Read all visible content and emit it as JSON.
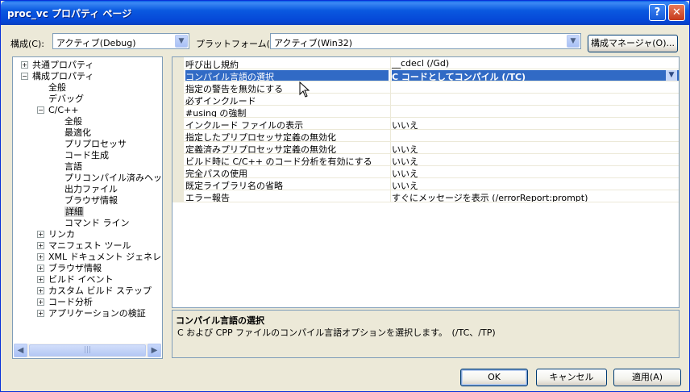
{
  "window": {
    "title": "proc_vc プロパティ ページ",
    "help_button": "?",
    "close_button": "✕"
  },
  "toolbar": {
    "config_label": "構成(C):",
    "config_value": "アクティブ(Debug)",
    "platform_label": "プラットフォーム(P):",
    "platform_value": "アクティブ(Win32)",
    "config_manager_button": "構成マネージャ(O)..."
  },
  "tree": {
    "items": [
      {
        "label": "共通プロパティ",
        "expander": "+"
      },
      {
        "label": "構成プロパティ",
        "expander": "−"
      },
      {
        "label": "全般"
      },
      {
        "label": "デバッグ"
      },
      {
        "label": "C/C++",
        "expander": "−"
      },
      {
        "label": "全般"
      },
      {
        "label": "最適化"
      },
      {
        "label": "プリプロセッサ"
      },
      {
        "label": "コード生成"
      },
      {
        "label": "言語"
      },
      {
        "label": "プリコンパイル済みヘッダー"
      },
      {
        "label": "出力ファイル"
      },
      {
        "label": "ブラウザ情報"
      },
      {
        "label": "詳細",
        "selected": true
      },
      {
        "label": "コマンド ライン"
      },
      {
        "label": "リンカ",
        "expander": "+"
      },
      {
        "label": "マニフェスト ツール",
        "expander": "+"
      },
      {
        "label": "XML ドキュメント ジェネレータ",
        "expander": "+"
      },
      {
        "label": "ブラウザ情報",
        "expander": "+"
      },
      {
        "label": "ビルド イベント",
        "expander": "+"
      },
      {
        "label": "カスタム ビルド ステップ",
        "expander": "+"
      },
      {
        "label": "コード分析",
        "expander": "+"
      },
      {
        "label": "アプリケーションの検証",
        "expander": "+"
      }
    ]
  },
  "properties": {
    "rows": [
      {
        "name": "呼び出し規約",
        "value": "__cdecl (/Gd)"
      },
      {
        "name": "コンパイル言語の選択",
        "value": "C コードとしてコンパイル (/TC)",
        "selected": true
      },
      {
        "name": "指定の警告を無効にする",
        "value": ""
      },
      {
        "name": "必ずインクルード",
        "value": ""
      },
      {
        "name": "#using の強制",
        "value": ""
      },
      {
        "name": "インクルード ファイルの表示",
        "value": "いいえ"
      },
      {
        "name": "指定したプリプロセッサ定義の無効化",
        "value": ""
      },
      {
        "name": "定義済みプリプロセッサ定義の無効化",
        "value": "いいえ"
      },
      {
        "name": "ビルド時に C/C++ のコード分析を有効にする",
        "value": "いいえ"
      },
      {
        "name": "完全パスの使用",
        "value": "いいえ"
      },
      {
        "name": "既定ライブラリ名の省略",
        "value": "いいえ"
      },
      {
        "name": "エラー報告",
        "value": "すぐにメッセージを表示 (/errorReport:prompt)"
      }
    ]
  },
  "description": {
    "title": "コンパイル言語の選択",
    "text": "C および CPP ファイルのコンパイル言語オプションを選択します。　(/TC、/TP)"
  },
  "buttons": {
    "ok": "OK",
    "cancel": "キャンセル",
    "apply": "適用(A)"
  }
}
